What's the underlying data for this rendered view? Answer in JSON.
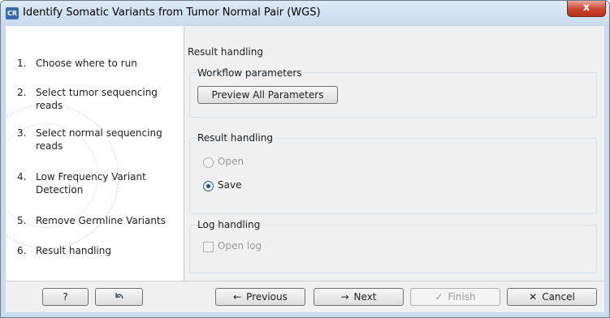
{
  "window": {
    "title": "Identify Somatic Variants from Tumor Normal Pair (WGS)",
    "app_icon_text": "CR",
    "close_glyph": "x"
  },
  "steps": [
    {
      "num": "1.",
      "label": "Choose where to run"
    },
    {
      "num": "2.",
      "label": "Select tumor sequencing reads"
    },
    {
      "num": "3.",
      "label": "Select normal sequencing reads"
    },
    {
      "num": "4.",
      "label": "Low Frequency Variant Detection"
    },
    {
      "num": "5.",
      "label": "Remove Germline Variants"
    },
    {
      "num": "6.",
      "label": "Result handling"
    }
  ],
  "main": {
    "section_title": "Result handling",
    "workflow_params": {
      "title": "Workflow parameters",
      "preview_button": "Preview All Parameters"
    },
    "result_handling": {
      "title": "Result handling",
      "open_label": "Open",
      "save_label": "Save",
      "selected": "Save"
    },
    "log_handling": {
      "title": "Log handling",
      "open_log_label": "Open log",
      "open_log_checked": false
    }
  },
  "footer": {
    "help_label": "?",
    "reset_icon": "reset-arrow-icon",
    "previous_label": "Previous",
    "next_label": "Next",
    "finish_label": "Finish",
    "cancel_label": "Cancel"
  },
  "colors": {
    "title_bar": "#c8dbee",
    "close_button": "#c9452f",
    "panel": "#f0f0f0",
    "disabled_text": "#9a9a9a"
  }
}
